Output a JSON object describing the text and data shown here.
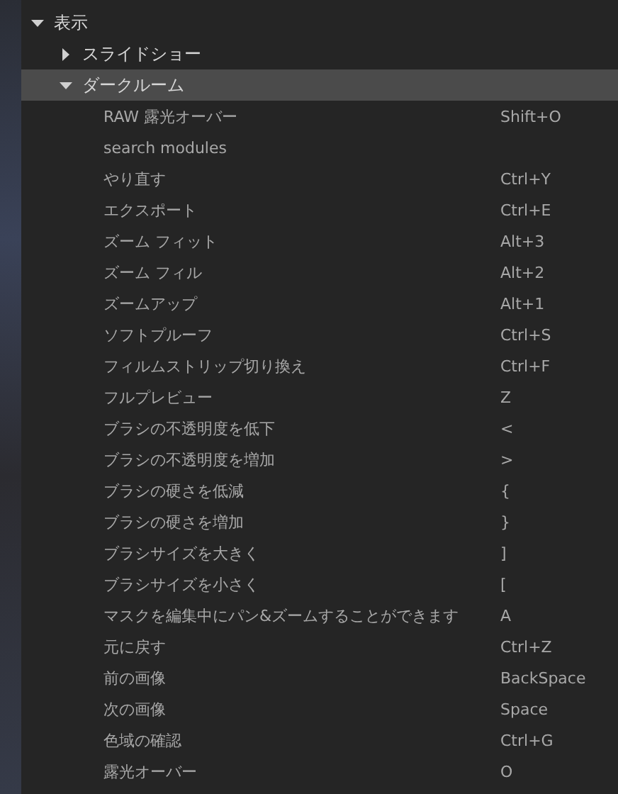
{
  "shortcut_tree": [
    {
      "label": "表示",
      "expanded": true,
      "selected": false,
      "children": [
        {
          "label": "スライドショー",
          "expanded": false,
          "selected": false
        },
        {
          "label": "ダークルーム",
          "expanded": true,
          "selected": true,
          "children": [
            {
              "label": "RAW 露光オーバー",
              "shortcut": "Shift+O"
            },
            {
              "label": "search modules"
            },
            {
              "label": "やり直す",
              "shortcut": "Ctrl+Y"
            },
            {
              "label": "エクスポート",
              "shortcut": "Ctrl+E"
            },
            {
              "label": "ズーム フィット",
              "shortcut": "Alt+3"
            },
            {
              "label": "ズーム フィル",
              "shortcut": "Alt+2"
            },
            {
              "label": "ズームアップ",
              "shortcut": "Alt+1"
            },
            {
              "label": "ソフトプルーフ",
              "shortcut": "Ctrl+S"
            },
            {
              "label": "フィルムストリップ切り換え",
              "shortcut": "Ctrl+F"
            },
            {
              "label": "フルプレビュー",
              "shortcut": "Z"
            },
            {
              "label": "ブラシの不透明度を低下",
              "shortcut": "<"
            },
            {
              "label": "ブラシの不透明度を増加",
              "shortcut": ">"
            },
            {
              "label": "ブラシの硬さを低減",
              "shortcut": "{"
            },
            {
              "label": "ブラシの硬さを増加",
              "shortcut": "}"
            },
            {
              "label": "ブラシサイズを大きく",
              "shortcut": "]"
            },
            {
              "label": "ブラシサイズを小さく",
              "shortcut": "["
            },
            {
              "label": "マスクを編集中にパン&ズームすることができます",
              "shortcut": "A"
            },
            {
              "label": "元に戻す",
              "shortcut": "Ctrl+Z"
            },
            {
              "label": "前の画像",
              "shortcut": "BackSpace"
            },
            {
              "label": "次の画像",
              "shortcut": "Space"
            },
            {
              "label": "色域の確認",
              "shortcut": "Ctrl+G"
            },
            {
              "label": "露光オーバー",
              "shortcut": "O"
            }
          ]
        }
      ]
    }
  ]
}
